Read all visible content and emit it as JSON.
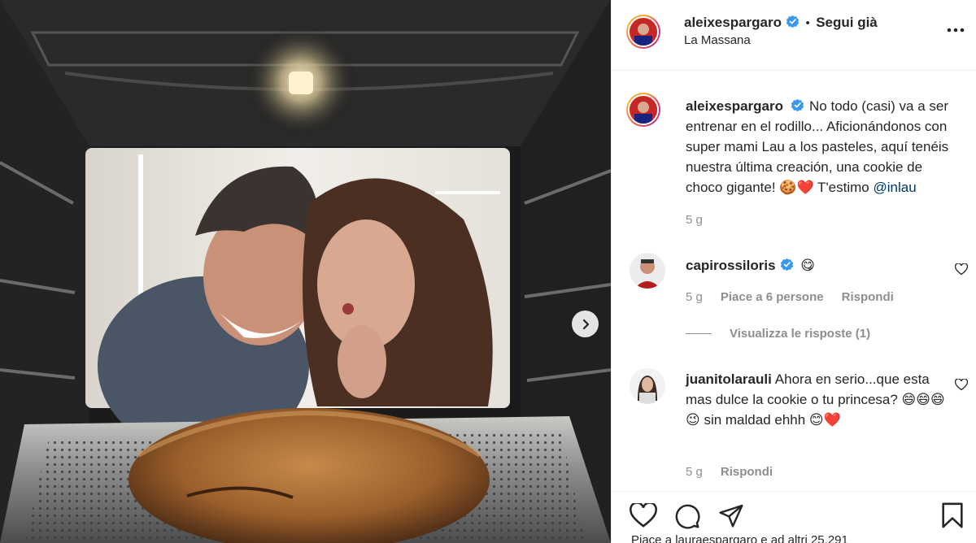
{
  "media": {
    "alt_people": "two people looking into an oven at a large cookie",
    "next_icon": "chevron-right-icon"
  },
  "header": {
    "username": "aleixespargaro",
    "separator": "•",
    "follow_status": "Segui già",
    "location": "La Massana",
    "more_icon": "ellipsis-icon"
  },
  "caption": {
    "username": "aleixespargaro",
    "text": "No todo (casi) va a ser entrenar en el rodillo... Aficionándonos con super mami Lau a los pasteles, aquí tenéis nuestra última creación, una cookie de choco gigante! 🍪❤️ T'estimo ",
    "mention": "@inlau",
    "time": "5 g"
  },
  "comments": [
    {
      "username": "capirossiloris",
      "text": "😋",
      "time": "5 g",
      "likes": "Piace a 6 persone",
      "reply": "Rispondi",
      "view_replies": "Visualizza le risposte (1)"
    },
    {
      "username": "juanitolarauli",
      "text": "Ahora en serio...que esta mas dulce la cookie o tu princesa? 😄😄😄😉 sin maldad ehhh 😊❤️",
      "time": "5 g",
      "reply": "Rispondi"
    }
  ],
  "actions": {
    "like_icon": "heart-icon",
    "comment_icon": "comment-icon",
    "share_icon": "share-icon",
    "save_icon": "bookmark-icon"
  },
  "likes_row": "Piace a lauraespargaro e ad altri 25.291",
  "colors": {
    "verified": "#3897f0",
    "link": "#00376b",
    "muted": "#8e8e8e"
  }
}
